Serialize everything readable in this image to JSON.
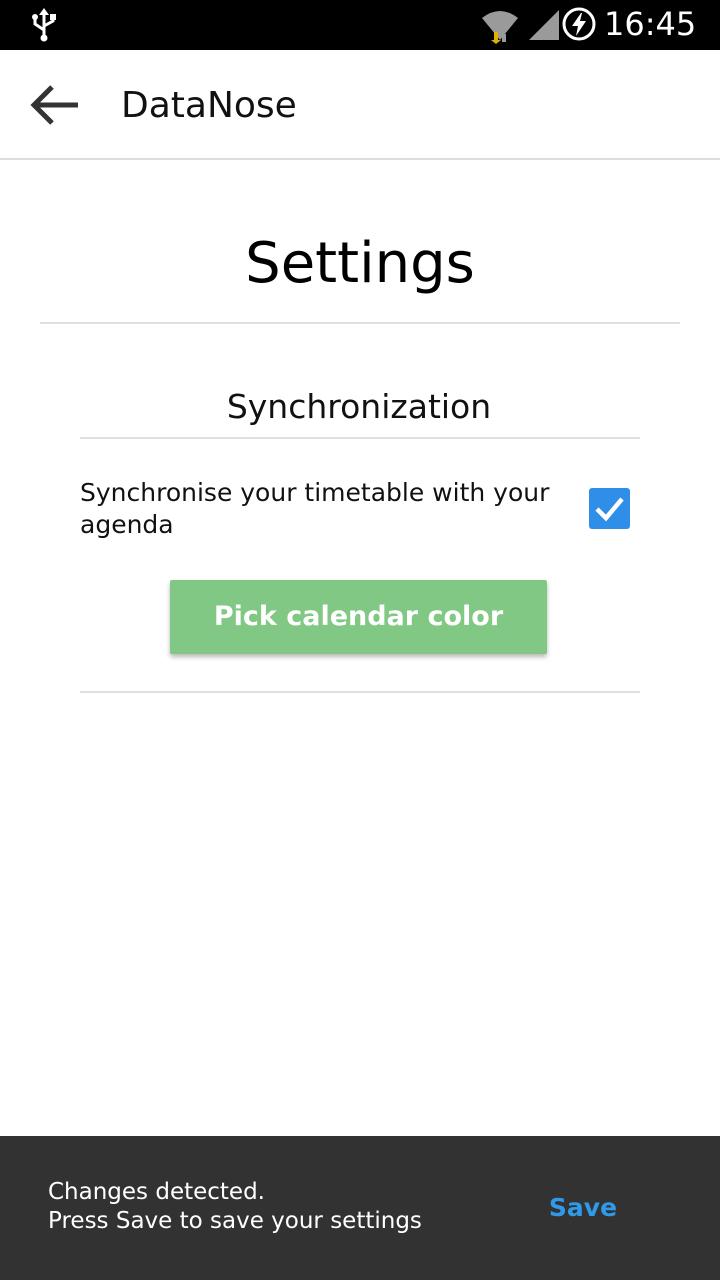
{
  "status_bar": {
    "time": "16:45",
    "icons": [
      "usb-icon",
      "wifi-icon",
      "signal-icon",
      "battery-charging-icon"
    ]
  },
  "app_bar": {
    "back_icon": "arrow-back-icon",
    "title": "DataNose"
  },
  "page": {
    "title": "Settings"
  },
  "synchronization": {
    "section_title": "Synchronization",
    "sync_label": "Synchronise your timetable with your agenda",
    "sync_checked": true,
    "pick_color_label": "Pick calendar color"
  },
  "snackbar": {
    "line1": "Changes detected.",
    "line2": "Press Save to save your settings",
    "action_label": "Save"
  },
  "colors": {
    "status_bar": "#000000",
    "checkbox": "#2f8fe8",
    "pick_button": "#80c883",
    "snackbar": "#323232",
    "snackbar_action": "#2f9ae8"
  }
}
